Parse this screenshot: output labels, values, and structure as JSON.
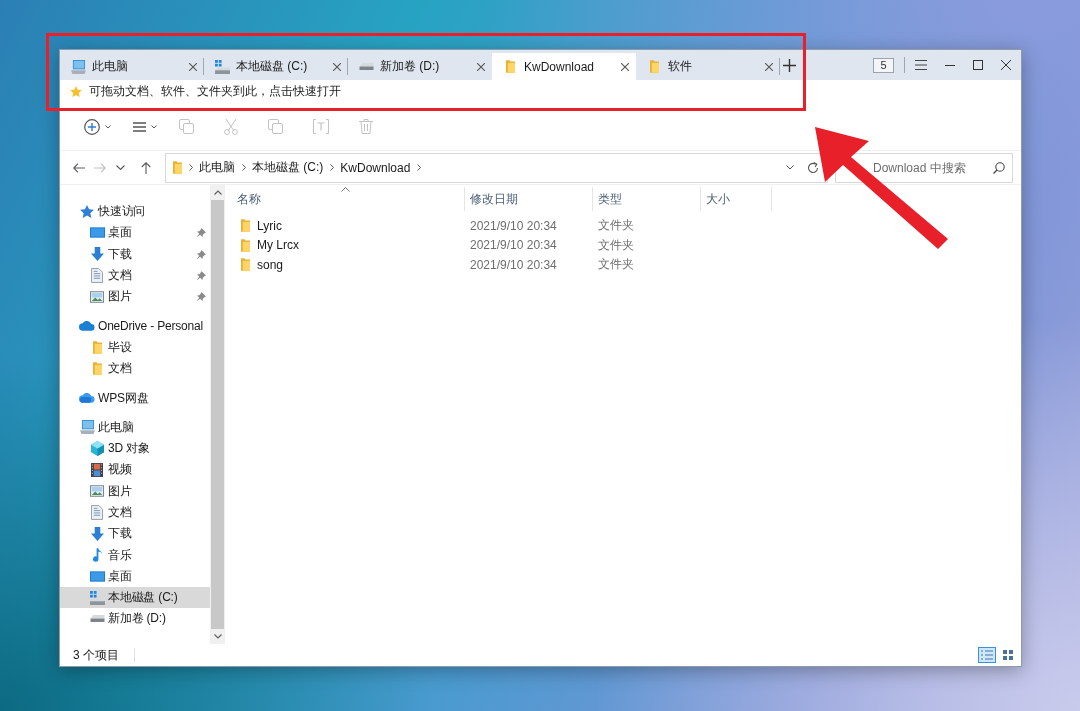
{
  "tabs": [
    {
      "label": "此电脑",
      "kind": "computer",
      "selected": false
    },
    {
      "label": "本地磁盘 (C:)",
      "kind": "sysdrive",
      "selected": false
    },
    {
      "label": "新加卷 (D:)",
      "kind": "drive",
      "selected": false
    },
    {
      "label": "KwDownload",
      "kind": "folder",
      "selected": true
    },
    {
      "label": "软件",
      "kind": "folder",
      "selected": false
    }
  ],
  "tab_count": "5",
  "quick_bar": {
    "hint": "可拖动文档、软件、文件夹到此，点击快速打开"
  },
  "toolbar": [
    {
      "kind": "new",
      "disabled": false
    },
    {
      "kind": "view",
      "disabled": false
    },
    {
      "kind": "copy",
      "disabled": true
    },
    {
      "kind": "cut",
      "disabled": true
    },
    {
      "kind": "copyto",
      "disabled": true
    },
    {
      "kind": "rename",
      "disabled": true
    },
    {
      "kind": "delete",
      "disabled": true
    }
  ],
  "navigation": [
    {
      "kind": "back",
      "disabled": false
    },
    {
      "kind": "forward",
      "disabled": true
    },
    {
      "kind": "recent",
      "disabled": false
    },
    {
      "kind": "up",
      "disabled": false
    }
  ],
  "address_bar": {
    "path": [
      "此电脑",
      "本地磁盘 (C:)",
      "KwDownload"
    ]
  },
  "search": {
    "placeholder": "Download 中搜索"
  },
  "sidebar": {
    "items": [
      {
        "label": "快速访问",
        "kind": "star",
        "selected": false,
        "children": [
          {
            "label": "桌面",
            "kind": "desktop",
            "selected": false,
            "pinned": true
          },
          {
            "label": "下载",
            "kind": "downloads",
            "selected": false,
            "pinned": true
          },
          {
            "label": "文档",
            "kind": "documents",
            "selected": false,
            "pinned": true
          },
          {
            "label": "图片",
            "kind": "pictures",
            "selected": false,
            "pinned": true
          }
        ]
      },
      {
        "label": "OneDrive - Personal",
        "kind": "cloud",
        "selected": false,
        "children": [
          {
            "label": "毕设",
            "kind": "folder",
            "selected": false
          },
          {
            "label": "文档",
            "kind": "folder",
            "selected": false
          }
        ]
      },
      {
        "label": "WPS网盘",
        "kind": "netdisk",
        "selected": false
      },
      {
        "label": "此电脑",
        "kind": "computer",
        "selected": false,
        "children": [
          {
            "label": "3D 对象",
            "kind": "cube",
            "selected": false
          },
          {
            "label": "视频",
            "kind": "video",
            "selected": false
          },
          {
            "label": "图片",
            "kind": "pictures",
            "selected": false
          },
          {
            "label": "文档",
            "kind": "documents",
            "selected": false
          },
          {
            "label": "下载",
            "kind": "downloads",
            "selected": false
          },
          {
            "label": "音乐",
            "kind": "music",
            "selected": false
          },
          {
            "label": "桌面",
            "kind": "desktop",
            "selected": false
          },
          {
            "label": "本地磁盘 (C:)",
            "kind": "sysdrive",
            "selected": true
          },
          {
            "label": "新加卷 (D:)",
            "kind": "drive",
            "selected": false
          }
        ]
      }
    ]
  },
  "table": {
    "columns": [
      {
        "label": "名称",
        "sorted": true
      },
      {
        "label": "修改日期",
        "sorted": false
      },
      {
        "label": "类型",
        "sorted": false
      },
      {
        "label": "大小",
        "sorted": false
      }
    ],
    "rows": [
      {
        "name": "Lyric",
        "modified": "2021/9/10 20:34",
        "type": "文件夹"
      },
      {
        "name": "My Lrcx",
        "modified": "2021/9/10 20:34",
        "type": "文件夹"
      },
      {
        "name": "song",
        "modified": "2021/9/10 20:34",
        "type": "文件夹"
      }
    ]
  },
  "status_bar": {
    "item_count": "3 个项目",
    "views": [
      {
        "kind": "details",
        "selected": true
      },
      {
        "kind": "tiles",
        "selected": false
      }
    ]
  },
  "annotation": {
    "frame": true,
    "arrow": true
  }
}
